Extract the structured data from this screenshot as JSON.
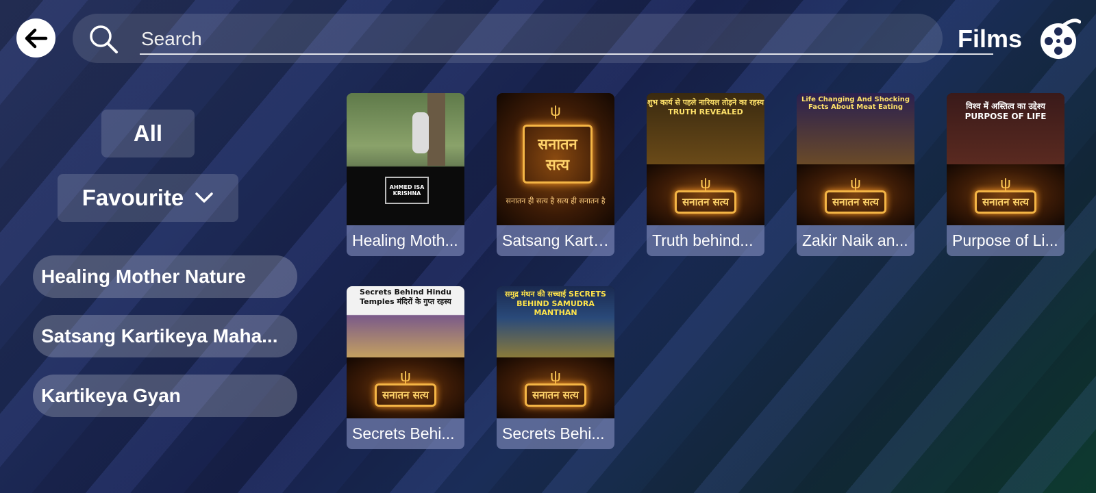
{
  "header": {
    "search_placeholder": "Search",
    "section_title": "Films",
    "back_icon": "arrow-left-icon",
    "search_icon": "search-icon",
    "films_icon": "film-reel-icon"
  },
  "filters": {
    "all_label": "All",
    "favourite_label": "Favourite"
  },
  "playlists": [
    {
      "label": "Healing Mother Nature"
    },
    {
      "label": "Satsang Kartikeya Maha..."
    },
    {
      "label": "Kartikeya Gyan"
    }
  ],
  "videos": [
    {
      "title": "Healing Moth...",
      "thumb_caption": "AHMED ISA KRISHNA"
    },
    {
      "title": "Satsang Karti...",
      "thumb_caption": "सनातन ही सत्य है सत्य ही सनातन है"
    },
    {
      "title": "Truth behind...",
      "thumb_caption": "शुभ कार्य से पहले नारियल तोड़ने का रहस्य TRUTH REVEALED"
    },
    {
      "title": "Zakir Naik an...",
      "thumb_caption": "Life Changing And Shocking Facts About Meat Eating"
    },
    {
      "title": "Purpose of Li...",
      "thumb_caption": "विश्व में अस्तित्व का उद्देश्य PURPOSE OF LIFE"
    },
    {
      "title": "Secrets Behi...",
      "thumb_caption": "Secrets Behind Hindu Temples मंदिरों के गुप्त रहस्य"
    },
    {
      "title": "Secrets Behi...",
      "thumb_caption": "समुद्र मंथन की सच्चाई SECRETS BEHIND SAMUDRA MANTHAN"
    }
  ],
  "logo_text": "सनातन सत्य",
  "colors": {
    "accent": "#f4b545"
  }
}
